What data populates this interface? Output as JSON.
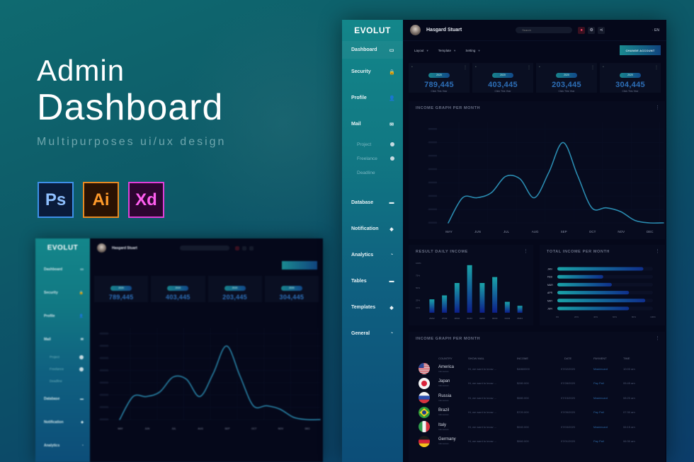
{
  "hero": {
    "title_line1": "Admin",
    "title_line2": "Dashboard",
    "subtitle": "Multipurposes ui/ux design",
    "app_icons": [
      {
        "label": "Ps",
        "name": "photoshop-icon",
        "color": "#3e8fe8"
      },
      {
        "label": "Ai",
        "name": "illustrator-icon",
        "color": "#e88a22"
      },
      {
        "label": "Xd",
        "name": "xd-icon",
        "color": "#e03fd8"
      }
    ]
  },
  "app": {
    "logo": "EVOLUT",
    "user_name": "Hasgard Stuart",
    "search_placeholder": "Search",
    "language": "EN",
    "accent_color": "#13868a",
    "value_color": "#2d6fb8"
  },
  "sidebar": {
    "items": [
      {
        "label": "Dashboard",
        "icon": "laptop-icon",
        "glyph": "▭"
      },
      {
        "label": "Security",
        "icon": "lock-icon",
        "glyph": "🔒"
      },
      {
        "label": "Profile",
        "icon": "user-icon",
        "glyph": "👤"
      },
      {
        "label": "Mail",
        "icon": "mail-icon",
        "glyph": "✉"
      },
      {
        "label": "Database",
        "icon": "database-icon",
        "glyph": "▬"
      },
      {
        "label": "Notification",
        "icon": "tag-icon",
        "glyph": "◆"
      },
      {
        "label": "Analytics",
        "icon": "pie-chart-icon",
        "glyph": "◔"
      },
      {
        "label": "Tables",
        "icon": "table-icon",
        "glyph": "▬"
      },
      {
        "label": "Templates",
        "icon": "tag-icon",
        "glyph": "◆"
      },
      {
        "label": "General",
        "icon": "pie-chart-icon",
        "glyph": "◔"
      }
    ],
    "mail_sub": [
      "Project",
      "Freelance",
      "Deadline"
    ]
  },
  "subbar": {
    "tabs": [
      "Layout",
      "Template",
      "Setting"
    ],
    "change_account": "CHANGE ACCOUNT"
  },
  "stats": [
    {
      "year": "2020",
      "value": "789,445",
      "label": "Click This Year"
    },
    {
      "year": "2020",
      "value": "403,445",
      "label": "Click This Year"
    },
    {
      "year": "2020",
      "value": "203,445",
      "label": "Click This Year"
    },
    {
      "year": "2020",
      "value": "304,445",
      "label": "Click This Year"
    }
  ],
  "chart_data": [
    {
      "type": "line",
      "title": "INCOME GRAPH PER MONTH",
      "categories": [
        "MAY",
        "JUN",
        "JUL",
        "AUG",
        "SEP",
        "OCT",
        "NOV",
        "DEC"
      ],
      "x": [
        0,
        0.5,
        1,
        1.5,
        2,
        2.5,
        3,
        3.5,
        4,
        4.5,
        5,
        5.5,
        6,
        6.5,
        7,
        7.5
      ],
      "values": [
        0,
        20,
        20,
        24,
        37,
        35,
        20,
        40,
        64,
        38,
        12,
        12,
        9,
        2,
        0,
        0
      ],
      "ylim": [
        0,
        80
      ],
      "grid": true
    },
    {
      "type": "bar",
      "title": "RESULT DAILY INCOME",
      "categories": [
        "26/02",
        "27/02",
        "28/02",
        "01/03",
        "02/03",
        "03/03",
        "04/03",
        "05/03"
      ],
      "values": [
        27,
        35,
        60,
        96,
        60,
        72,
        22,
        14
      ],
      "yticks": [
        "10%",
        "25%",
        "50%",
        "75%",
        "100%"
      ],
      "ylim": [
        0,
        100
      ]
    },
    {
      "type": "bar",
      "orientation": "horizontal",
      "title": "TOTAL INCOME PER MONTH",
      "categories": [
        "JAN",
        "FEB",
        "MAR",
        "APR",
        "MAY",
        "JUN"
      ],
      "values": [
        90,
        48,
        57,
        75,
        92,
        75
      ],
      "xticks": [
        "0%",
        "20%",
        "40%",
        "60%",
        "80%",
        "100%"
      ],
      "xlim": [
        0,
        100
      ]
    }
  ],
  "table": {
    "title": "INCOME GRAPH PER MONTH",
    "columns": [
      "COUNTRY",
      "SHOW MAIL",
      "INCOME",
      "DATE",
      "PAYMENT",
      "TIME"
    ],
    "rows": [
      {
        "flag": "usa",
        "country": "America",
        "sub": "Indonesian",
        "mail": "Hi, we want to know ...",
        "income": "$4860000",
        "date": "07/02/2020",
        "payment": "Mastercard",
        "time": "10:00 am"
      },
      {
        "flag": "japan",
        "country": "Japan",
        "sub": "Indonesian",
        "mail": "Hi, we want to know ...",
        "income": "$280.000",
        "date": "07/28/2020",
        "payment": "Pay Pall",
        "time": "05:45 am"
      },
      {
        "flag": "russia",
        "country": "Russia",
        "sub": "Indonesian",
        "mail": "Hi, we want to know ...",
        "income": "$580.000",
        "date": "07/15/2020",
        "payment": "Mastercard",
        "time": "08:20 am"
      },
      {
        "flag": "brazil",
        "country": "Brazil",
        "sub": "Indonesian",
        "mail": "Hi, we want to know ...",
        "income": "$720.000",
        "date": "07/05/2020",
        "payment": "Pay Pall",
        "time": "07:30 am"
      },
      {
        "flag": "italy",
        "country": "Italy",
        "sub": "Indonesian",
        "mail": "Hi, we want to know ...",
        "income": "$940.000",
        "date": "07/03/2020",
        "payment": "Mastercard",
        "time": "06:15 am"
      },
      {
        "flag": "germany",
        "country": "Germany",
        "sub": "Indonesian",
        "mail": "Hi, we want to know ...",
        "income": "$560.000",
        "date": "07/01/2020",
        "payment": "Pay Pall",
        "time": "06:30 am"
      }
    ]
  }
}
